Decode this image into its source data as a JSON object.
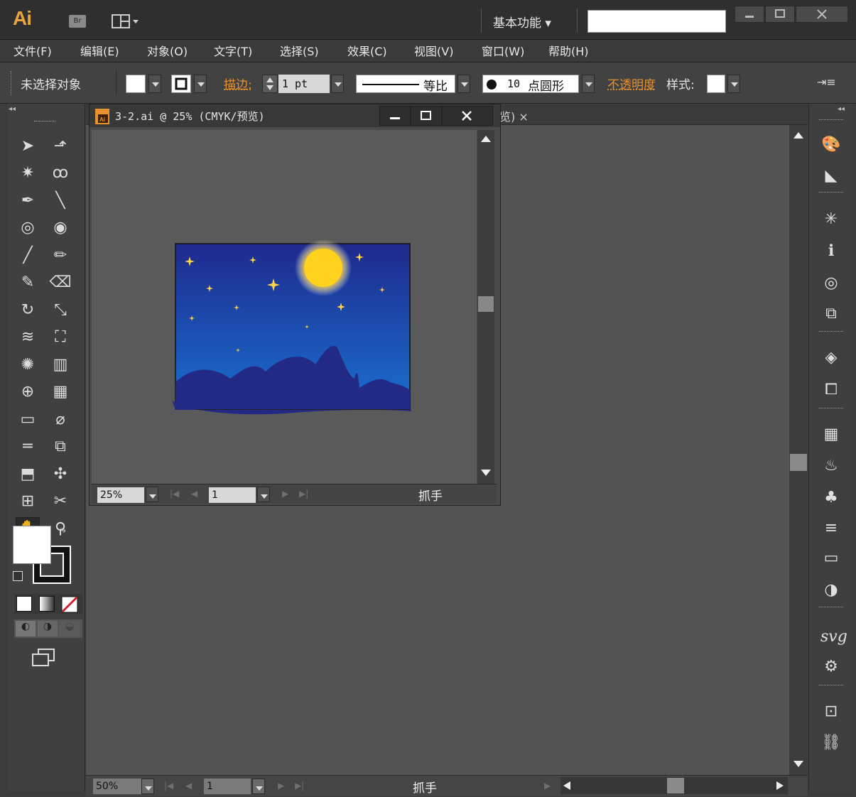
{
  "app": {
    "logo": "Ai",
    "bridge_label": "Br",
    "workspace": "基本功能 ▾"
  },
  "menu": [
    "文件(F)",
    "编辑(E)",
    "对象(O)",
    "文字(T)",
    "选择(S)",
    "效果(C)",
    "视图(V)",
    "窗口(W)",
    "帮助(H)"
  ],
  "control": {
    "selection_status": "未选择对象",
    "stroke_label": "描边:",
    "stroke_value": "1 pt",
    "profile_label": "等比",
    "brush_size": "10",
    "brush_name": "点圆形",
    "opacity_label": "不透明度",
    "style_label": "样式:"
  },
  "document": {
    "title": "3-2.ai @ 25% (CMYK/预览)",
    "background_tab_fragment": "览) ×",
    "zoom": "25%",
    "page": "1",
    "tool_status": "抓手"
  },
  "main_status": {
    "zoom": "50%",
    "page": "1",
    "tool_status": "抓手"
  },
  "colors": {
    "ui_bg": "#535353",
    "accent_orange": "#e8912d",
    "sky_top": "#1e2a8c",
    "sky_bottom": "#1a6fd0",
    "mountain": "#232a86",
    "moon": "#ffd21e",
    "star": "#ffd24a"
  },
  "tools": [
    "selection-icon",
    "direct-selection-icon",
    "magic-wand-icon",
    "lasso-icon",
    "pen-icon",
    "line-icon",
    "polar-grid-icon",
    "spiral-icon",
    "paintbrush-icon",
    "pencil-icon",
    "blob-brush-icon",
    "eraser-icon",
    "rotate-icon",
    "scale-icon",
    "warp-icon",
    "free-transform-icon",
    "symbol-sprayer-icon",
    "column-graph-icon",
    "shape-builder-icon",
    "mesh-icon",
    "gradient-icon",
    "eyedropper-icon",
    "measure-icon",
    "blend-icon",
    "slice-icon",
    "symbol-icon",
    "artboard-icon",
    "scissors-icon",
    "hand-icon",
    "zoom-icon"
  ],
  "right_panels": [
    "color-icon",
    "color-guide-icon",
    "brushes-icon",
    "info-icon",
    "appearance-icon",
    "transform-icon",
    "layers-icon",
    "artboards-icon",
    "swatches-icon",
    "symbols-icon",
    "stroke-icon",
    "align-icon",
    "gradient-panel-icon",
    "transparency-icon",
    "svg-interactivity-icon",
    "graphic-styles-icon",
    "document-info-icon",
    "links-icon"
  ],
  "right_labels": {
    "svg": "svg"
  }
}
